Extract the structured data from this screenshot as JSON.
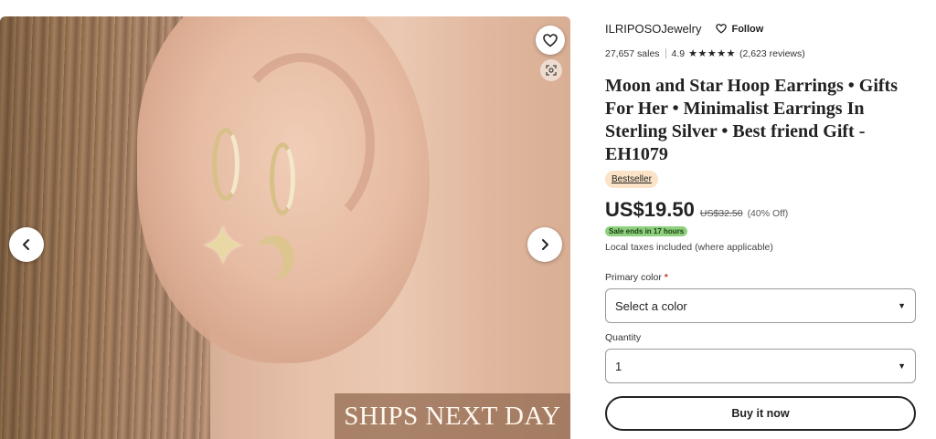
{
  "gallery": {
    "banner_text": "SHIPS NEXT DAY",
    "icons": {
      "prev": "chevron-left-icon",
      "next": "chevron-right-icon",
      "favorite": "heart-icon",
      "visual_search": "camera-scan-icon"
    }
  },
  "shop": {
    "name": "ILRIPOSOJewelry",
    "follow_label": "Follow",
    "sales": "27,657 sales",
    "rating": "4.9",
    "stars": "★★★★★",
    "reviews": "(2,623 reviews)"
  },
  "listing": {
    "title": "Moon and Star Hoop Earrings • Gifts For Her • Minimalist Earrings In Sterling Silver • Best friend Gift - EH1079",
    "badge": "Bestseller",
    "price": "US$19.50",
    "original_price": "US$32.50",
    "discount": "(40% Off)",
    "sale_notice": "Sale ends in 17 hours",
    "taxes_note": "Local taxes included (where applicable)"
  },
  "options": {
    "color_label": "Primary color",
    "color_required_mark": "*",
    "color_value": "Select a color",
    "quantity_label": "Quantity",
    "quantity_value": "1"
  },
  "actions": {
    "buy_label": "Buy it now"
  },
  "colors": {
    "sale_badge": "#8ed07d",
    "bestseller_badge": "#fbe3c7",
    "required_mark": "#c0392b"
  }
}
